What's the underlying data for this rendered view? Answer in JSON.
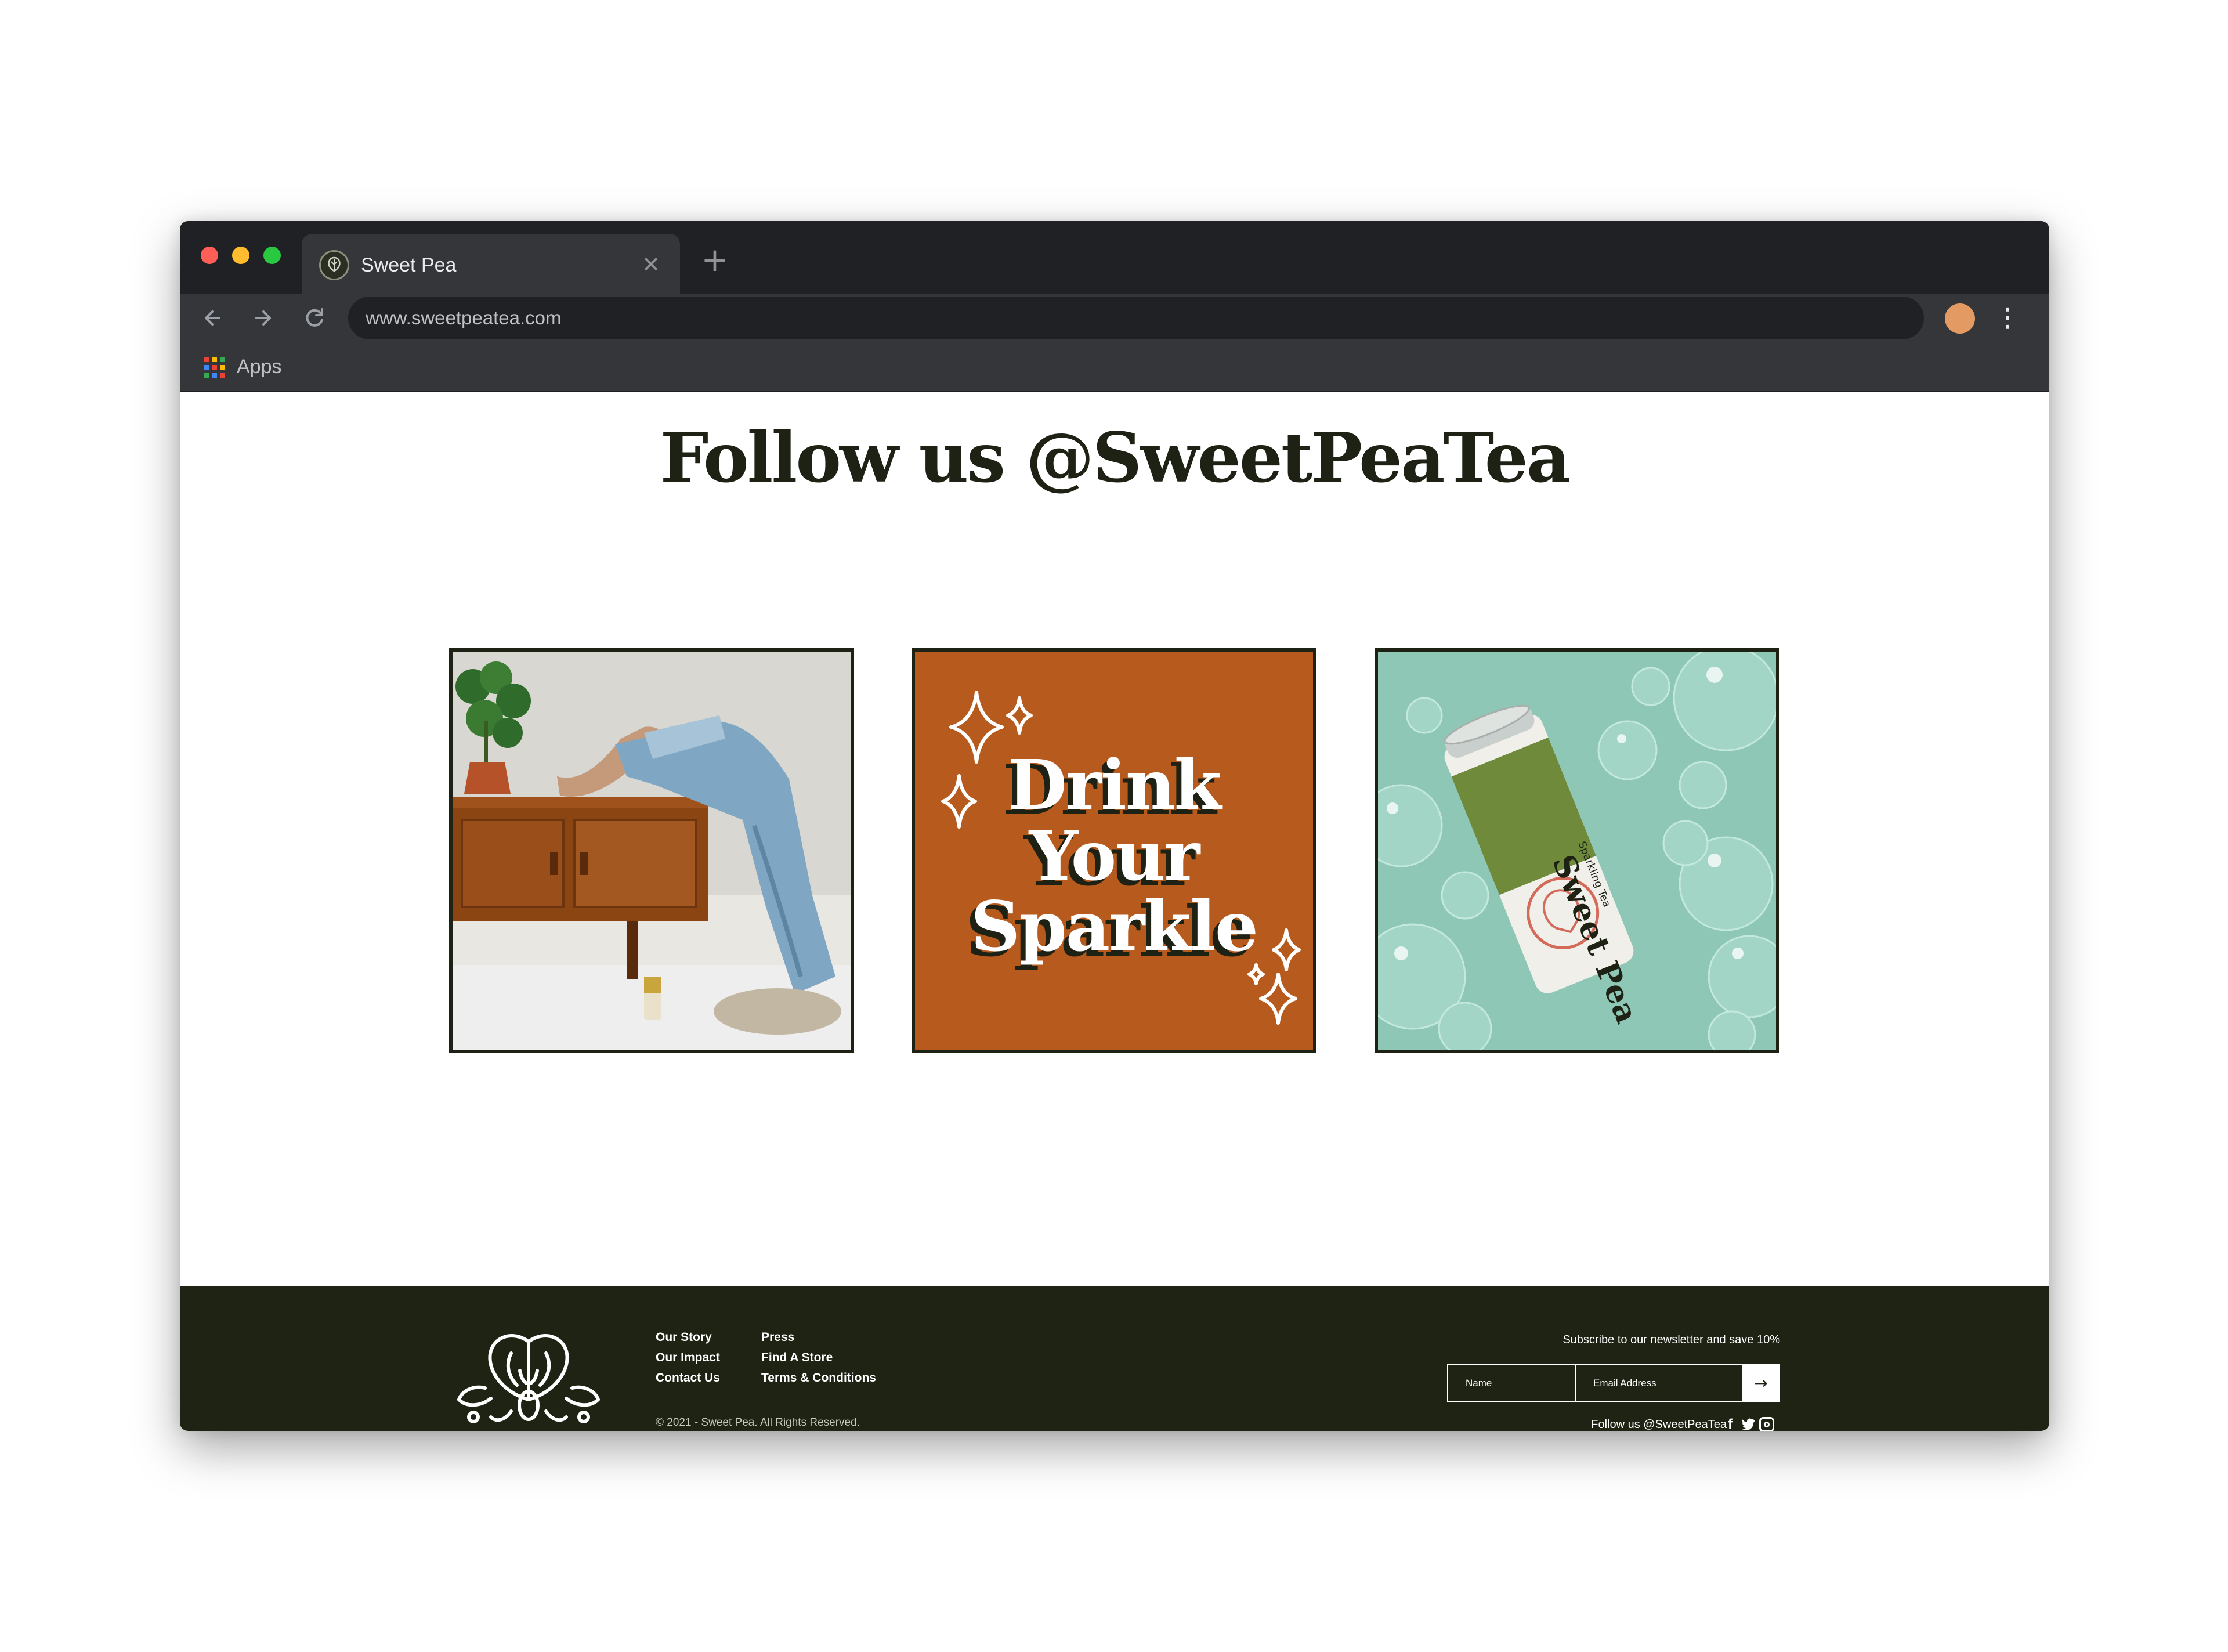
{
  "browser": {
    "tab_title": "Sweet Pea",
    "url": "www.sweetpeatea.com",
    "bookmarks_label": "Apps",
    "apps_colors": [
      "#ea4335",
      "#fbbc05",
      "#34a853",
      "#4285f4",
      "#ea4335",
      "#fbbc05",
      "#34a853",
      "#4285f4",
      "#ea4335"
    ]
  },
  "main": {
    "heading": "Follow us @SweetPeaTea",
    "tiles": [
      {
        "description": "Person with bare feet up on a wooden cabinet beside a potted plant and a can of Sweet Pea"
      },
      {
        "lines": [
          "Drink",
          "Your",
          "Sparkle"
        ]
      },
      {
        "can_text": "Sweet Pea",
        "can_subtext": "Sparkling Tea"
      }
    ]
  },
  "footer": {
    "links_col1": [
      "Our Story",
      "Our Impact",
      "Contact Us"
    ],
    "links_col2": [
      "Press",
      "Find A Store",
      "Terms & Conditions"
    ],
    "copyright": "© 2021 - Sweet Pea. All Rights Reserved.",
    "newsletter_label": "Subscribe to our newsletter and save 10%",
    "name_placeholder": "Name",
    "email_placeholder": "Email Address",
    "submit_icon": "arrow-right-icon",
    "follow_text": "Follow us @SweetPeaTea",
    "social_icons": [
      "facebook-icon",
      "twitter-icon",
      "instagram-icon"
    ]
  },
  "colors": {
    "dark_olive": "#1f2314",
    "orange_tile": "#b65a1d",
    "mint_tile": "#8fc7b7",
    "avatar": "#e39a63"
  }
}
